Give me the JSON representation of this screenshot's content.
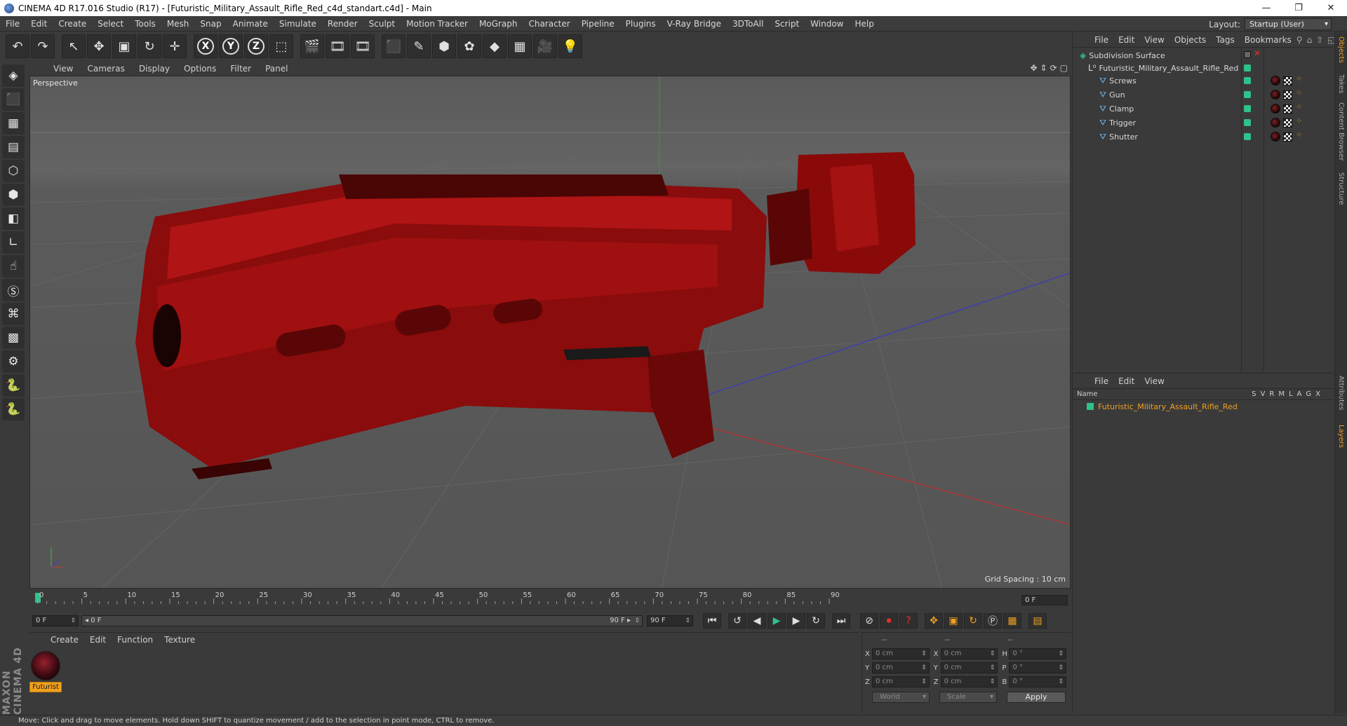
{
  "window": {
    "title": "CINEMA 4D R17.016 Studio (R17) - [Futuristic_Military_Assault_Rifle_Red_c4d_standart.c4d] - Main",
    "minimize": "—",
    "restore": "❐",
    "close": "✕"
  },
  "menu": [
    "File",
    "Edit",
    "Create",
    "Select",
    "Tools",
    "Mesh",
    "Snap",
    "Animate",
    "Simulate",
    "Render",
    "Sculpt",
    "Motion Tracker",
    "MoGraph",
    "Character",
    "Pipeline",
    "Plugins",
    "V-Ray Bridge",
    "3DToAll",
    "Script",
    "Window",
    "Help"
  ],
  "layout": {
    "label": "Layout:",
    "value": "Startup (User)"
  },
  "toolbar": {
    "undo": "↶",
    "redo": "↷",
    "select": "↖",
    "move": "✥",
    "scale": "▣",
    "rotate": "↻",
    "live": "✛",
    "x": "X",
    "y": "Y",
    "z": "Z",
    "coord": "⬚",
    "render1": "🎬",
    "render2": "🎞",
    "render3": "🎞",
    "cube": "⬛",
    "pen": "✎",
    "subdiv": "⬢",
    "mograph": "✿",
    "deform": "◆",
    "floor": "▦",
    "camera": "🎥",
    "light": "💡"
  },
  "left_tools": [
    "◈",
    "⬛",
    "▦",
    "▤",
    "⬡",
    "⬢",
    "◧",
    "∟",
    "☝",
    "Ⓢ",
    "⌘",
    "▩",
    "⚙",
    "🐍",
    "🐍"
  ],
  "maxon_logo": "MAXON CINEMA 4D",
  "viewport": {
    "menu": [
      "View",
      "Cameras",
      "Display",
      "Options",
      "Filter",
      "Panel"
    ],
    "nav_icons": [
      "✥",
      "⇕",
      "⟳",
      "▢"
    ],
    "camera_label": "Perspective",
    "grid_spacing": "Grid Spacing : 10 cm"
  },
  "timeline": {
    "ticks": [
      "0",
      "5",
      "10",
      "15",
      "20",
      "25",
      "30",
      "35",
      "40",
      "45",
      "50",
      "55",
      "60",
      "65",
      "70",
      "75",
      "80",
      "85",
      "90"
    ],
    "end_field": "0 F"
  },
  "playback": {
    "current": "0 F",
    "range_start": "◂ 0 F",
    "range_end": "90 F ▸",
    "max": "90 F",
    "buttons": [
      "⏮",
      "↺",
      "◀",
      "▶",
      "▶",
      "↻",
      "⏭"
    ],
    "key_buttons": [
      "⊘",
      "⏺",
      "?",
      "✥",
      "▣",
      "↻",
      "Ⓟ",
      "▦",
      "▤"
    ]
  },
  "material_manager": {
    "menu": [
      "Create",
      "Edit",
      "Function",
      "Texture"
    ],
    "material_name": "Futurist"
  },
  "coordinates": {
    "headers": [
      "--",
      "--",
      "--"
    ],
    "rows": [
      {
        "a1": "X",
        "v1": "0 cm",
        "a2": "X",
        "v2": "0 cm",
        "a3": "H",
        "v3": "0 °"
      },
      {
        "a1": "Y",
        "v1": "0 cm",
        "a2": "Y",
        "v2": "0 cm",
        "a3": "P",
        "v3": "0 °"
      },
      {
        "a1": "Z",
        "v1": "0 cm",
        "a2": "Z",
        "v2": "0 cm",
        "a3": "B",
        "v3": "0 °"
      }
    ],
    "world": "World",
    "scale": "Scale",
    "apply": "Apply"
  },
  "status": "Move: Click and drag to move elements. Hold down SHIFT to quantize movement / add to the selection in point mode, CTRL to remove.",
  "object_manager": {
    "menu": [
      "File",
      "Edit",
      "View",
      "Objects",
      "Tags",
      "Bookmarks"
    ],
    "items": [
      {
        "name": "Subdivision Surface",
        "icon": "◈"
      },
      {
        "name": "Futuristic_Military_Assault_Rifle_Red",
        "icon": "L⁰"
      },
      {
        "name": "Screws",
        "icon": "⛛"
      },
      {
        "name": "Gun",
        "icon": "⛛"
      },
      {
        "name": "Clamp",
        "icon": "⛛"
      },
      {
        "name": "Trigger",
        "icon": "⛛"
      },
      {
        "name": "Shutter",
        "icon": "⛛"
      }
    ]
  },
  "layer_manager": {
    "menu": [
      "File",
      "Edit",
      "View"
    ],
    "name_header": "Name",
    "columns": [
      "S",
      "V",
      "R",
      "M",
      "L",
      "A",
      "G",
      "X"
    ],
    "layer_name": "Futuristic_Military_Assault_Rifle_Red"
  },
  "side_tabs": [
    "Objects",
    "Takes",
    "Content Browser",
    "Structure",
    "Attributes",
    "Layers"
  ],
  "colors": {
    "accent": "#f0a020",
    "layer_green": "#2ec28a",
    "model_red": "#b01010"
  }
}
